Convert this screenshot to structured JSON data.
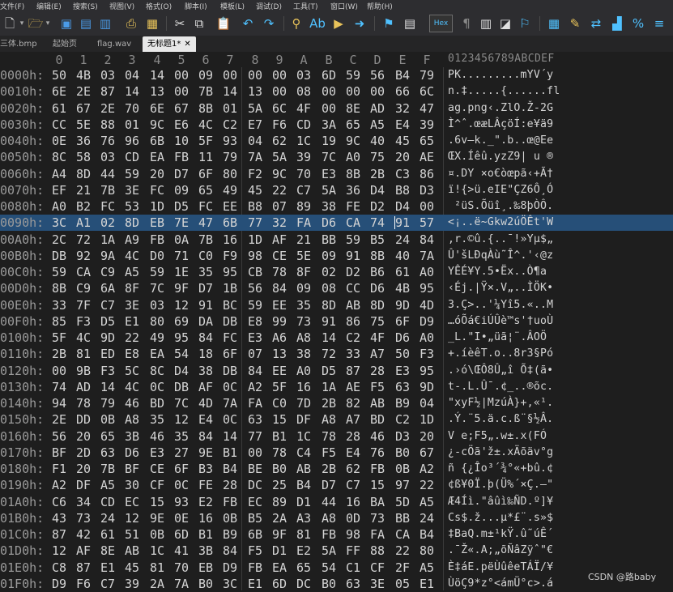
{
  "menu": [
    "文件(F)",
    "编辑(E)",
    "搜索(S)",
    "视图(V)",
    "格式(O)",
    "脚本(I)",
    "模板(L)",
    "调试(D)",
    "工具(T)",
    "窗口(W)",
    "帮助(H)"
  ],
  "toolbar": {
    "hex_label": "Hex",
    "icons": [
      "new-file-icon",
      "open-folder-icon",
      "save-icon",
      "save-as-icon",
      "save-all-icon",
      "print-icon",
      "cut-icon",
      "copy-icon",
      "paste-icon",
      "paste-special-icon",
      "undo-icon",
      "redo-icon",
      "find-icon",
      "replace-icon",
      "find-in-files-icon",
      "goto-icon",
      "bookmark-icon",
      "bookmark-list-icon",
      "hex-mode-icon",
      "pilcrow-icon",
      "columns-icon",
      "highlight-icon",
      "calculator-icon",
      "inspector-icon",
      "compare-icon",
      "histogram-icon",
      "percent-icon",
      "checksum-icon"
    ]
  },
  "tabs": [
    {
      "label": "三体.bmp",
      "active": false
    },
    {
      "label": "起始页",
      "active": false
    },
    {
      "label": "flag.wav",
      "active": false
    },
    {
      "label": "无标题1*",
      "active": true
    }
  ],
  "hex": {
    "column_headers": [
      "0",
      "1",
      "2",
      "3",
      "4",
      "5",
      "6",
      "7",
      "8",
      "9",
      "A",
      "B",
      "C",
      "D",
      "E",
      "F"
    ],
    "ascii_header": "0123456789ABCDEF",
    "highlighted_row": 9,
    "rows": [
      {
        "offset": "0000h:",
        "bytes": [
          "50",
          "4B",
          "03",
          "04",
          "14",
          "00",
          "09",
          "00",
          "00",
          "00",
          "03",
          "6D",
          "59",
          "56",
          "B4",
          "79"
        ],
        "ascii": "PK.........mYV´y"
      },
      {
        "offset": "0010h:",
        "bytes": [
          "6E",
          "2E",
          "87",
          "14",
          "13",
          "00",
          "7B",
          "14",
          "13",
          "00",
          "08",
          "00",
          "00",
          "00",
          "66",
          "6C"
        ],
        "ascii": "n.‡.....{......fl"
      },
      {
        "offset": "0020h:",
        "bytes": [
          "61",
          "67",
          "2E",
          "70",
          "6E",
          "67",
          "8B",
          "01",
          "5A",
          "6C",
          "4F",
          "00",
          "8E",
          "AD",
          "32",
          "47"
        ],
        "ascii": "ag.png‹.ZlO.Ž-2G"
      },
      {
        "offset": "0030h:",
        "bytes": [
          "CC",
          "5E",
          "88",
          "01",
          "9C",
          "E6",
          "4C",
          "C2",
          "E7",
          "F6",
          "CD",
          "3A",
          "65",
          "A5",
          "E4",
          "39"
        ],
        "ascii": "Ì^ˆ.œæLÂçöÍ:e¥ä9"
      },
      {
        "offset": "0040h:",
        "bytes": [
          "0E",
          "36",
          "76",
          "96",
          "6B",
          "10",
          "5F",
          "93",
          "04",
          "62",
          "1C",
          "19",
          "9C",
          "40",
          "45",
          "65"
        ],
        "ascii": ".6v–k._\".b..œ@Ee"
      },
      {
        "offset": "0050h:",
        "bytes": [
          "8C",
          "58",
          "03",
          "CD",
          "EA",
          "FB",
          "11",
          "79",
          "7A",
          "5A",
          "39",
          "7C",
          "A0",
          "75",
          "20",
          "AE"
        ],
        "ascii": "ŒX.Íêû.yzZ9| u ®"
      },
      {
        "offset": "0060h:",
        "bytes": [
          "A4",
          "8D",
          "44",
          "59",
          "20",
          "D7",
          "6F",
          "80",
          "F2",
          "9C",
          "70",
          "E3",
          "8B",
          "2B",
          "C3",
          "86"
        ],
        "ascii": "¤.DY ×o€òœpã‹+Ã†"
      },
      {
        "offset": "0070h:",
        "bytes": [
          "EF",
          "21",
          "7B",
          "3E",
          "FC",
          "09",
          "65",
          "49",
          "45",
          "22",
          "C7",
          "5A",
          "36",
          "D4",
          "B8",
          "D3"
        ],
        "ascii": "ï!{>ü.eIE\"ÇZ6Ô¸Ó"
      },
      {
        "offset": "0080h:",
        "bytes": [
          "A0",
          "B2",
          "FC",
          "53",
          "1D",
          "D5",
          "FC",
          "EE",
          "B8",
          "07",
          "89",
          "38",
          "FE",
          "D2",
          "D4",
          "00"
        ],
        "ascii": " ²üS.Õüî¸.‰8þÒÔ."
      },
      {
        "offset": "0090h:",
        "bytes": [
          "3C",
          "A1",
          "02",
          "8D",
          "EB",
          "7E",
          "47",
          "6B",
          "77",
          "32",
          "FA",
          "D6",
          "CA",
          "74",
          "91",
          "57"
        ],
        "ascii": "<¡..ë~Gkw2úÖÊt'W"
      },
      {
        "offset": "00A0h:",
        "bytes": [
          "2C",
          "72",
          "1A",
          "A9",
          "FB",
          "0A",
          "7B",
          "16",
          "1D",
          "AF",
          "21",
          "BB",
          "59",
          "B5",
          "24",
          "84"
        ],
        "ascii": ",r.©û.{..¯!»Yµ$„"
      },
      {
        "offset": "00B0h:",
        "bytes": [
          "DB",
          "92",
          "9A",
          "4C",
          "D0",
          "71",
          "C0",
          "F9",
          "98",
          "CE",
          "5E",
          "09",
          "91",
          "8B",
          "40",
          "7A"
        ],
        "ascii": "Û'šLÐqÀù˜Î^.'‹@z"
      },
      {
        "offset": "00C0h:",
        "bytes": [
          "59",
          "CA",
          "C9",
          "A5",
          "59",
          "1E",
          "35",
          "95",
          "CB",
          "78",
          "8F",
          "02",
          "D2",
          "B6",
          "61",
          "A0"
        ],
        "ascii": "YÊÉ¥Y.5•Ëx..Ò¶a "
      },
      {
        "offset": "00D0h:",
        "bytes": [
          "8B",
          "C9",
          "6A",
          "8F",
          "7C",
          "9F",
          "D7",
          "1B",
          "56",
          "84",
          "09",
          "08",
          "CC",
          "D6",
          "4B",
          "95"
        ],
        "ascii": "‹Éj.|Ÿ×.V„..ÌÖK•"
      },
      {
        "offset": "00E0h:",
        "bytes": [
          "33",
          "7F",
          "C7",
          "3E",
          "03",
          "12",
          "91",
          "BC",
          "59",
          "EE",
          "35",
          "8D",
          "AB",
          "8D",
          "9D",
          "4D"
        ],
        "ascii": "3.Ç>..'¼Yî5.«..M"
      },
      {
        "offset": "00F0h:",
        "bytes": [
          "85",
          "F3",
          "D5",
          "E1",
          "80",
          "69",
          "DA",
          "DB",
          "E8",
          "99",
          "73",
          "91",
          "86",
          "75",
          "6F",
          "D9"
        ],
        "ascii": "…óÕá€iÚÛè™s'†uoÙ"
      },
      {
        "offset": "0100h:",
        "bytes": [
          "5F",
          "4C",
          "9D",
          "22",
          "49",
          "95",
          "84",
          "FC",
          "E3",
          "A6",
          "A8",
          "14",
          "C2",
          "4F",
          "D6",
          "A0"
        ],
        "ascii": "_L.\"I•„üã¦¨.ÂOÖ "
      },
      {
        "offset": "0110h:",
        "bytes": [
          "2B",
          "81",
          "ED",
          "E8",
          "EA",
          "54",
          "18",
          "6F",
          "07",
          "13",
          "38",
          "72",
          "33",
          "A7",
          "50",
          "F3"
        ],
        "ascii": "+.íèêT.o..8r3§Pó"
      },
      {
        "offset": "0120h:",
        "bytes": [
          "00",
          "9B",
          "F3",
          "5C",
          "8C",
          "D4",
          "38",
          "DB",
          "84",
          "EE",
          "A0",
          "D5",
          "87",
          "28",
          "E3",
          "95"
        ],
        "ascii": ".›ó\\ŒÔ8Û„î Õ‡(ã•"
      },
      {
        "offset": "0130h:",
        "bytes": [
          "74",
          "AD",
          "14",
          "4C",
          "0C",
          "DB",
          "AF",
          "0C",
          "A2",
          "5F",
          "16",
          "1A",
          "AE",
          "F5",
          "63",
          "9D"
        ],
        "ascii": "t-.L.Û¯.¢_..®õc."
      },
      {
        "offset": "0140h:",
        "bytes": [
          "94",
          "78",
          "79",
          "46",
          "BD",
          "7C",
          "4D",
          "7A",
          "FA",
          "C0",
          "7D",
          "2B",
          "82",
          "AB",
          "B9",
          "04"
        ],
        "ascii": "\"xyF½|MzúÀ}+‚«¹."
      },
      {
        "offset": "0150h:",
        "bytes": [
          "2E",
          "DD",
          "0B",
          "A8",
          "35",
          "12",
          "E4",
          "0C",
          "63",
          "15",
          "DF",
          "A8",
          "A7",
          "BD",
          "C2",
          "1D"
        ],
        "ascii": ".Ý.¨5.ä.c.ß¨§½Â."
      },
      {
        "offset": "0160h:",
        "bytes": [
          "56",
          "20",
          "65",
          "3B",
          "46",
          "35",
          "84",
          "14",
          "77",
          "B1",
          "1C",
          "78",
          "28",
          "46",
          "D3",
          "20"
        ],
        "ascii": "V e;F5„.w±.x(FÓ "
      },
      {
        "offset": "0170h:",
        "bytes": [
          "BF",
          "2D",
          "63",
          "D6",
          "E3",
          "27",
          "9E",
          "B1",
          "00",
          "78",
          "C4",
          "F5",
          "E4",
          "76",
          "B0",
          "67"
        ],
        "ascii": "¿-cÖã'ž±.xÄõäv°g"
      },
      {
        "offset": "0180h:",
        "bytes": [
          "F1",
          "20",
          "7B",
          "BF",
          "CE",
          "6F",
          "B3",
          "B4",
          "BE",
          "B0",
          "AB",
          "2B",
          "62",
          "FB",
          "0B",
          "A2"
        ],
        "ascii": "ñ {¿Îo³´¾°«+bû.¢"
      },
      {
        "offset": "0190h:",
        "bytes": [
          "A2",
          "DF",
          "A5",
          "30",
          "CF",
          "0C",
          "FE",
          "28",
          "DC",
          "25",
          "B4",
          "D7",
          "C7",
          "15",
          "97",
          "22"
        ],
        "ascii": "¢ß¥0Ï.þ(Ü%´×Ç.—\""
      },
      {
        "offset": "01A0h:",
        "bytes": [
          "C6",
          "34",
          "CD",
          "EC",
          "15",
          "93",
          "E2",
          "FB",
          "EC",
          "89",
          "D1",
          "44",
          "16",
          "BA",
          "5D",
          "A5"
        ],
        "ascii": "Æ4Íì.\"âûì‰ÑD.º]¥"
      },
      {
        "offset": "01B0h:",
        "bytes": [
          "43",
          "73",
          "24",
          "12",
          "9E",
          "0E",
          "16",
          "0B",
          "B5",
          "2A",
          "A3",
          "A8",
          "0D",
          "73",
          "BB",
          "24"
        ],
        "ascii": "Cs$.ž...µ*£¨.s»$"
      },
      {
        "offset": "01C0h:",
        "bytes": [
          "87",
          "42",
          "61",
          "51",
          "0B",
          "6D",
          "B1",
          "B9",
          "6B",
          "9F",
          "81",
          "FB",
          "98",
          "FA",
          "CA",
          "B4"
        ],
        "ascii": "‡BaQ.m±¹kŸ.û˜úÊ´"
      },
      {
        "offset": "01D0h:",
        "bytes": [
          "12",
          "AF",
          "8E",
          "AB",
          "1C",
          "41",
          "3B",
          "84",
          "F5",
          "D1",
          "E2",
          "5A",
          "FF",
          "88",
          "22",
          "80"
        ],
        "ascii": ".¯Ž«.A;„õÑâZÿˆ\"€"
      },
      {
        "offset": "01E0h:",
        "bytes": [
          "C8",
          "87",
          "E1",
          "45",
          "81",
          "70",
          "EB",
          "D9",
          "FB",
          "EA",
          "65",
          "54",
          "C1",
          "CF",
          "2F",
          "A5"
        ],
        "ascii": "È‡áE.pëÙûêeTÁÏ/¥"
      },
      {
        "offset": "01F0h:",
        "bytes": [
          "D9",
          "F6",
          "C7",
          "39",
          "2A",
          "7A",
          "B0",
          "3C",
          "E1",
          "6D",
          "DC",
          "B0",
          "63",
          "3E",
          "05",
          "E1"
        ],
        "ascii": "ÙöÇ9*z°<ámÜ°c>.á"
      }
    ]
  },
  "watermark": "CSDN @路baby"
}
